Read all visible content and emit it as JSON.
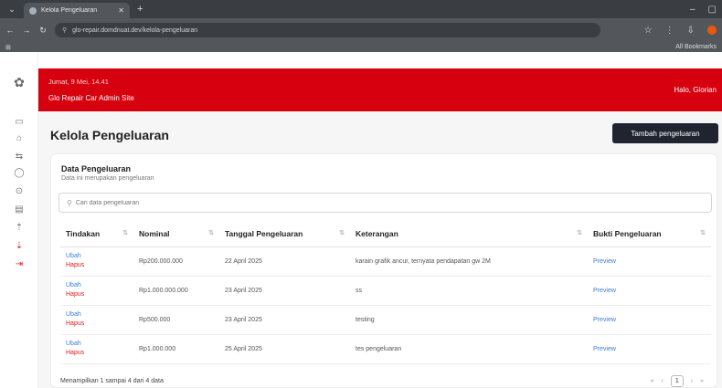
{
  "browser": {
    "tab_title": "Kelola Pengeluaran",
    "url": "glo-repair.domdnuat.dev/kelola-pengeluaran",
    "bookmarks_label": "All Bookmarks"
  },
  "banner": {
    "date": "Jumat, 9 Mei, 14.41",
    "site": "Glo Repair Car Admin Site",
    "greeting": "Halo, Glorian"
  },
  "page": {
    "title": "Kelola Pengeluaran",
    "add_button": "Tambah pengeluaran"
  },
  "card": {
    "title": "Data Pengeluaran",
    "subtitle": "Data ini merupakan pengeluaran",
    "search_placeholder": "Cari data pengeluaran"
  },
  "table": {
    "headers": [
      "Tindakan",
      "Nominal",
      "Tanggal Pengeluaran",
      "Keterangan",
      "Bukti Pengeluaran"
    ],
    "ubah_label": "Ubah",
    "hapus_label": "Hapus",
    "rows": [
      {
        "nominal": "Rp200.000.000",
        "tanggal": "22 April 2025",
        "keterangan": "karain grafik ancur, ternyata pendapatan gw 2M",
        "bukti": "Preview"
      },
      {
        "nominal": "Rp1.000.000.000",
        "tanggal": "23 April 2025",
        "keterangan": "ss",
        "bukti": "Preview"
      },
      {
        "nominal": "Rp500.000",
        "tanggal": "23 April 2025",
        "keterangan": "testing",
        "bukti": "Preview"
      },
      {
        "nominal": "Rp1.000.000",
        "tanggal": "25 April 2025",
        "keterangan": "tes pengeluaran",
        "bukti": "Preview"
      }
    ]
  },
  "footer": {
    "info": "Menampilkan 1 sampai 4 dari 4 data",
    "current_page": "1"
  }
}
